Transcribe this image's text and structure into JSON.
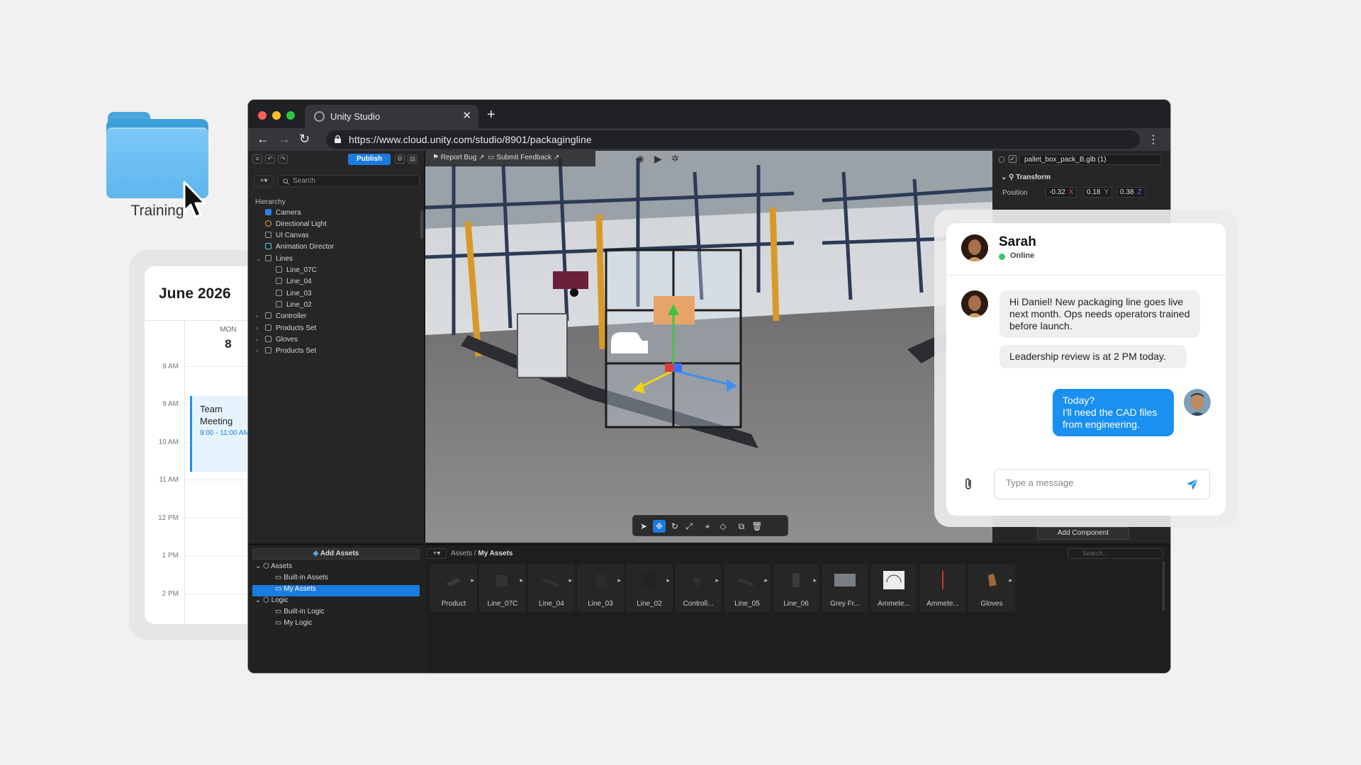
{
  "desktop": {
    "folder_label": "Training"
  },
  "calendar": {
    "title": "June 2026",
    "day_name": "MON",
    "day_number": "8",
    "times": [
      "8 AM",
      "9 AM",
      "10 AM",
      "11 AM",
      "12 PM",
      "1 PM",
      "2 PM"
    ],
    "event": {
      "title": "Team Meeting",
      "time": "9:00 - 11:00 AM",
      "color": "#1b93ea"
    }
  },
  "browser": {
    "tab_title": "Unity Studio",
    "url": "https://www.cloud.unity.com/studio/8901/packagingline",
    "traffic_lights": [
      "#ff5f57",
      "#febc2e",
      "#28c840"
    ]
  },
  "editor": {
    "toolbar": {
      "publish_label": "Publish",
      "report_bug_label": "Report Bug",
      "submit_feedback_label": "Submit Feedback"
    },
    "search_placeholder": "Search",
    "hierarchy": {
      "label": "Hierarchy",
      "items": [
        {
          "label": "Camera",
          "icon": "camera-icon",
          "depth": 0
        },
        {
          "label": "Directional Light",
          "icon": "light-icon",
          "depth": 0
        },
        {
          "label": "UI Canvas",
          "icon": "canvas-icon",
          "depth": 0
        },
        {
          "label": "Animation Director",
          "icon": "animation-icon",
          "depth": 0
        },
        {
          "label": "Lines",
          "icon": "cube-icon",
          "depth": 0,
          "expanded": true
        },
        {
          "label": "Line_07C",
          "icon": "cube-icon",
          "depth": 1
        },
        {
          "label": "Line_04",
          "icon": "cube-icon",
          "depth": 1
        },
        {
          "label": "Line_03",
          "icon": "cube-icon",
          "depth": 1
        },
        {
          "label": "Line_02",
          "icon": "cube-icon",
          "depth": 1
        },
        {
          "label": "Controller",
          "icon": "cube-icon",
          "depth": 0,
          "collapsed": true
        },
        {
          "label": "Products Set",
          "icon": "cube-icon",
          "depth": 0,
          "collapsed": true
        },
        {
          "label": "Gloves",
          "icon": "cube-icon",
          "depth": 0,
          "collapsed": true
        },
        {
          "label": "Products Set",
          "icon": "cube-icon",
          "depth": 0,
          "collapsed": true
        }
      ]
    },
    "inspector": {
      "object_name": "pallet_box_pack_B.glb (1)",
      "section": "Transform",
      "position_label": "Position",
      "position": {
        "x": "-0.32",
        "y": "0.18",
        "z": "0.38"
      },
      "axis_labels": [
        "X",
        "Y",
        "Z"
      ],
      "add_component_label": "Add Component"
    },
    "assets_panel": {
      "add_assets_label": "Add Assets",
      "tree": [
        {
          "label": "Assets",
          "depth": 0
        },
        {
          "label": "Built-in Assets",
          "depth": 1
        },
        {
          "label": "My Assets",
          "depth": 1,
          "selected": true
        },
        {
          "label": "Logic",
          "depth": 0
        },
        {
          "label": "Built-in Logic",
          "depth": 1
        },
        {
          "label": "My Logic",
          "depth": 1
        }
      ],
      "breadcrumb_root": "Assets",
      "breadcrumb_current": "My Assets",
      "search_placeholder": "Search...",
      "items": [
        "Product",
        "Line_07C",
        "Line_04",
        "Line_03",
        "Line_02",
        "Controll...",
        "Line_05",
        "Line_06",
        "Grey Fr...",
        "Ammete...",
        "Ammete...",
        "Gloves"
      ]
    }
  },
  "chat": {
    "contact_name": "Sarah",
    "status": "Online",
    "messages": [
      {
        "from": "them",
        "text": "Hi Daniel! New packaging line goes live next month. Ops needs operators trained before launch."
      },
      {
        "from": "them",
        "text": "Leadership review is at 2 PM today."
      },
      {
        "from": "me",
        "text": "Today?\nI'll need the CAD files from engineering."
      }
    ],
    "input_placeholder": "Type a message",
    "accent": "#1a90f0"
  }
}
